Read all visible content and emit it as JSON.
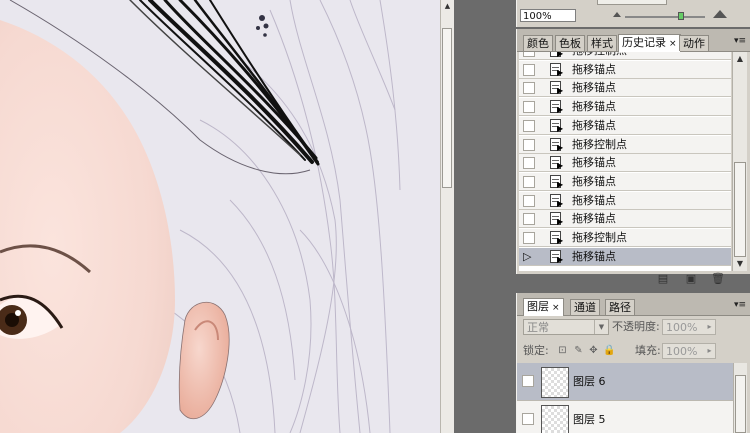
{
  "navigator": {
    "zoom": "100%",
    "zoom_level": 0.7
  },
  "history_panel": {
    "tabs": [
      {
        "label": "颜色",
        "active": false
      },
      {
        "label": "色板",
        "active": false
      },
      {
        "label": "样式",
        "active": false
      },
      {
        "label": "历史记录",
        "active": true
      },
      {
        "label": "动作",
        "active": false
      }
    ],
    "tab_close": "×",
    "items": [
      {
        "label": "拖移控制点",
        "active": false
      },
      {
        "label": "拖移锚点",
        "active": false
      },
      {
        "label": "拖移锚点",
        "active": false
      },
      {
        "label": "拖移锚点",
        "active": false
      },
      {
        "label": "拖移锚点",
        "active": false
      },
      {
        "label": "拖移控制点",
        "active": false
      },
      {
        "label": "拖移锚点",
        "active": false
      },
      {
        "label": "拖移锚点",
        "active": false
      },
      {
        "label": "拖移锚点",
        "active": false
      },
      {
        "label": "拖移锚点",
        "active": false
      },
      {
        "label": "拖移控制点",
        "active": false
      },
      {
        "label": "拖移锚点",
        "active": true
      }
    ]
  },
  "layers_panel": {
    "tabs": [
      {
        "label": "图层",
        "active": true
      },
      {
        "label": "通道",
        "active": false
      },
      {
        "label": "路径",
        "active": false
      }
    ],
    "tab_close": "×",
    "blend_mode": "正常",
    "opacity_label": "不透明度:",
    "opacity_value": "100%",
    "lock_label": "锁定:",
    "fill_label": "填充:",
    "fill_value": "100%",
    "layers": [
      {
        "name": "图层 6",
        "active": true
      },
      {
        "name": "图层 5",
        "active": false
      }
    ]
  },
  "colors": {
    "active_row": "#b8bcc7",
    "panel_bg": "#d4d0c8",
    "workspace": "#6b6b6b"
  }
}
